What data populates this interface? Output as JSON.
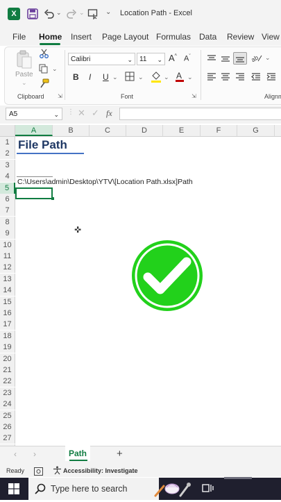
{
  "window": {
    "title": "Location Path - Excel",
    "app_icon": "X"
  },
  "quick_access": {
    "save_icon": "save-icon",
    "undo_icon": "undo-icon",
    "redo_icon": "redo-icon",
    "customize_icon": "customize-icon"
  },
  "ribbon_tabs": [
    "File",
    "Home",
    "Insert",
    "Page Layout",
    "Formulas",
    "Data",
    "Review",
    "View"
  ],
  "active_tab": "Home",
  "ribbon": {
    "clipboard": {
      "paste_label": "Paste",
      "group_label": "Clipboard"
    },
    "font": {
      "font_name": "Calibri",
      "font_size": "11",
      "grow": "A",
      "shrink": "A",
      "bold": "B",
      "italic": "I",
      "underline": "U",
      "group_label": "Font"
    },
    "alignment": {
      "group_label": "Alignm"
    }
  },
  "formula_bar": {
    "name_box": "A5",
    "fx": "fx",
    "formula": ""
  },
  "columns": [
    "A",
    "B",
    "C",
    "D",
    "E",
    "F",
    "G"
  ],
  "rows": [
    "1",
    "2",
    "3",
    "4",
    "5",
    "6",
    "7",
    "8",
    "9",
    "10",
    "11",
    "12",
    "13",
    "14",
    "15",
    "16",
    "17",
    "18",
    "19",
    "20",
    "21",
    "22",
    "23",
    "24",
    "25",
    "26",
    "27"
  ],
  "selected": {
    "column": "A",
    "row": "5"
  },
  "cells": {
    "A1": "File Path",
    "A4": "C:\\Users\\admin\\Desktop\\YTV\\[Location Path.xlsx]Path"
  },
  "sheet_tabs": [
    "Path"
  ],
  "status": {
    "ready": "Ready",
    "accessibility": "Accessibility: Investigate"
  },
  "taskbar": {
    "search_placeholder": "Type here to search"
  },
  "colors": {
    "excel_green": "#107c41",
    "check_green": "#22d11b",
    "title_blue": "#1f3864"
  }
}
